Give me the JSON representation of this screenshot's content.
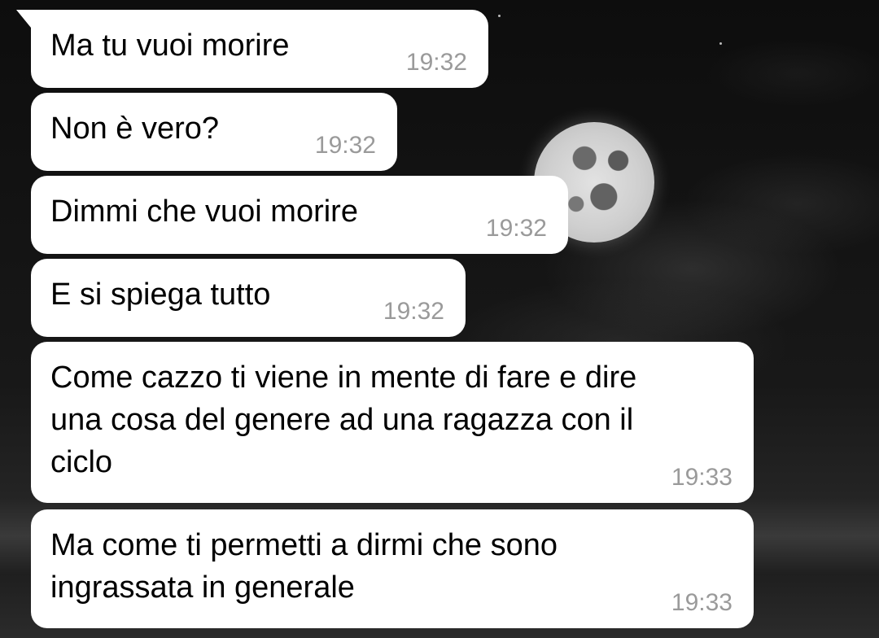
{
  "chat": {
    "messages": [
      {
        "text": "Ma tu vuoi morire",
        "time": "19:32"
      },
      {
        "text": "Non è vero?",
        "time": "19:32"
      },
      {
        "text": "Dimmi che vuoi morire",
        "time": "19:32"
      },
      {
        "text": "E si spiega tutto",
        "time": "19:32"
      },
      {
        "text": "Come cazzo ti viene in mente di fare e dire\nuna cosa del genere ad una ragazza con il\nciclo",
        "time": "19:33"
      },
      {
        "text": "Ma come ti permetti a dirmi che sono\ningrassata in generale",
        "time": "19:33"
      }
    ]
  },
  "colors": {
    "bubble": "#ffffff",
    "text": "#000000",
    "timestamp": "#9a9a9a",
    "wallpaper": "#121212"
  },
  "wallpaper": {
    "description_icon": "night-moon-wallpaper"
  }
}
